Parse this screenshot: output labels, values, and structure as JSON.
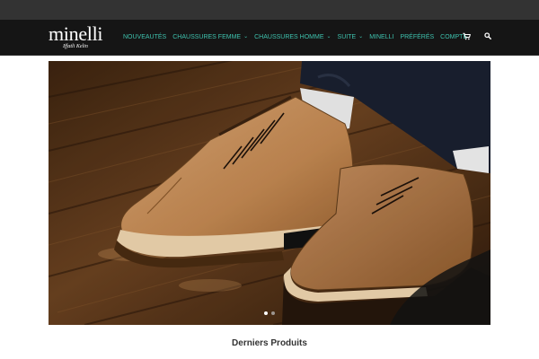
{
  "brand": {
    "name": "minelli",
    "tagline": "Iffatli Kelin"
  },
  "nav": {
    "items": [
      {
        "label": "NOUVEAUTÉS",
        "dropdown": false
      },
      {
        "label": "CHAUSSURES FEMME",
        "dropdown": true
      },
      {
        "label": "CHAUSSURES HOMME",
        "dropdown": true
      },
      {
        "label": "SUITE",
        "dropdown": true
      },
      {
        "label": "MINELLI",
        "dropdown": false
      },
      {
        "label": "PRÉFÉRÉS",
        "dropdown": false
      },
      {
        "label": "COMPTE",
        "dropdown": false
      }
    ],
    "icons": [
      "cart-icon",
      "search-icon"
    ]
  },
  "hero": {
    "slides_total": 2,
    "active_slide": 1
  },
  "section": {
    "title": "Derniers Produits"
  },
  "colors": {
    "accent": "#3ec1ad",
    "header_bg": "#151515",
    "topbar_bg": "#333333"
  }
}
